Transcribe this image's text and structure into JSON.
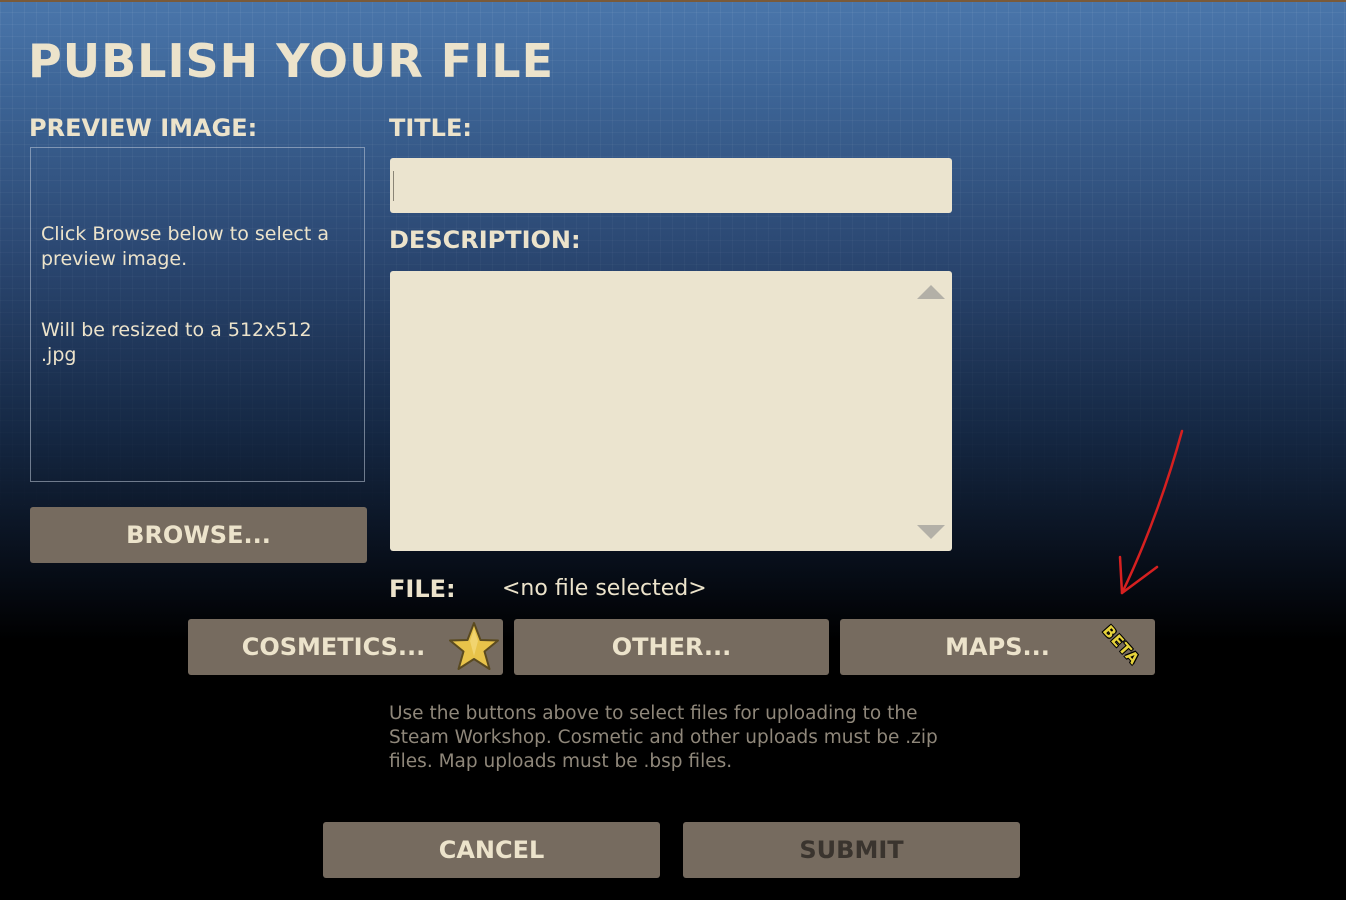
{
  "page": {
    "title": "PUBLISH YOUR FILE"
  },
  "preview": {
    "label": "PREVIEW IMAGE:",
    "instructions": "Click Browse below to select a preview image.",
    "resize_note": "Will be resized to a 512x512 .jpg",
    "browse_label": "BROWSE..."
  },
  "title_field": {
    "label": "TITLE:",
    "value": ""
  },
  "description_field": {
    "label": "DESCRIPTION:",
    "value": ""
  },
  "file": {
    "label": "FILE:",
    "value": "<no file selected>"
  },
  "file_buttons": {
    "cosmetics_label": "COSMETICS...",
    "other_label": "OTHER...",
    "maps_label": "MAPS...",
    "maps_badge": "BETA"
  },
  "help_text": "Use the buttons above to select files for uploading to the Steam Workshop. Cosmetic and other uploads must be .zip files. Map uploads must be .bsp files.",
  "actions": {
    "cancel_label": "CANCEL",
    "submit_label": "SUBMIT"
  },
  "icons": {
    "star": "star-icon",
    "scroll_up": "triangle-up-icon",
    "scroll_down": "triangle-down-icon",
    "annotation": "red-arrow-annotation"
  },
  "colors": {
    "text_cream": "#ece3cb",
    "button_bg": "#766b5f",
    "input_bg": "#ebe4cf",
    "help_text": "#8f877a",
    "star_gold": "#e8c34a",
    "beta_yellow": "#e6d23c",
    "annotation_red": "#d62020"
  }
}
